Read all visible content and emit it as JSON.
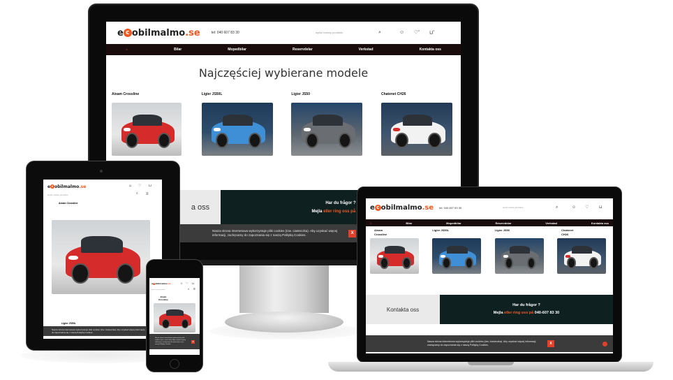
{
  "brand": {
    "logo_e": "e",
    "logo_dot": "c",
    "logo_main": "obilmalmo",
    "logo_tld": ".se",
    "phone": "tel: 040 607 83 30",
    "colors": {
      "accent": "#f05a22",
      "nav_bg": "#1a0c0c",
      "band_dark": "#0f2020",
      "cookie_bg": "#3b3b3b",
      "cookie_close": "#e0412b"
    }
  },
  "icons": {
    "search": "search-icon",
    "user": "user-icon",
    "heart": "heart-icon",
    "cart": "cart-icon",
    "home": "home-icon",
    "close": "close-icon",
    "menu": "hamburger-icon"
  },
  "header": {
    "search_placeholder": "wpisz nazwę produktu",
    "wishlist_count": "0",
    "cart_count": "0"
  },
  "nav": {
    "home": "⌂",
    "items": [
      "Bilar",
      "Mopedbilar",
      "Reservdelar",
      "Verkstad",
      "Kontakta oss"
    ]
  },
  "section": {
    "title": "Najczęściej wybierane modele"
  },
  "models": [
    {
      "name": "Aixam Crossline",
      "color": "#d62b2b"
    },
    {
      "name": "Ligier JS50L",
      "color": "#3f8fd6"
    },
    {
      "name": "Ligier JS50",
      "color": "#6a6e72"
    },
    {
      "name": "Chatenet CH26",
      "color": "#f2f2f2"
    }
  ],
  "tablet_model_names": [
    "Aixam Crossline",
    "Ligier JS50L"
  ],
  "phone_model_names": [
    "Aixam",
    "Crossline"
  ],
  "laptop_model_names": [
    "Aixam\nCrossline",
    "Ligier JS50L",
    "Ligier JS50",
    "Chatenet\nCH26"
  ],
  "contact": {
    "left_label": "Kontakta oss",
    "left_partial": "a oss",
    "question": "Har du frågor ?",
    "call_prefix": "Mejla",
    "call_orange": "eller ring oss på",
    "call_number": "040-607 83 30",
    "call_number_short": "040-60"
  },
  "cookie": {
    "text": "Nasza strona internetowa wykorzystuje pliki cookies (tzw. ciasteczka). Aby uzyskać więcej informacji, zachęcamy do zapoznania się z naszą Polityką Cookies.",
    "close": "X"
  }
}
